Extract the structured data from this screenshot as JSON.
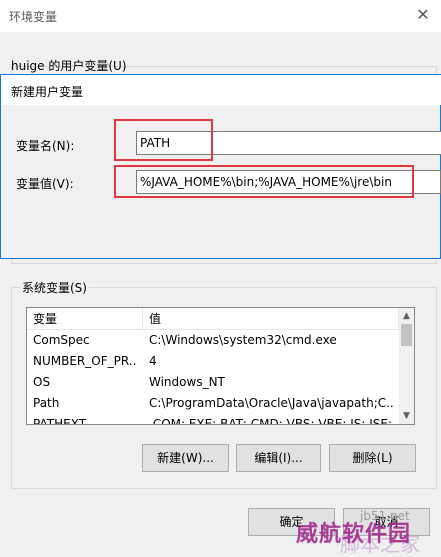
{
  "outer_window": {
    "title": "环境变量",
    "close_glyph": "✕",
    "user_vars_label": "huige 的用户变量(U)",
    "system_vars_label": "系统变量(S)"
  },
  "dialog": {
    "title": "新建用户变量",
    "name_label": "变量名(N):",
    "name_value": "PATH",
    "value_label": "变量值(V):",
    "value_value": "%JAVA_HOME%\\bin;%JAVA_HOME%\\jre\\bin"
  },
  "system_table": {
    "headers": [
      "变量",
      "值"
    ],
    "rows": [
      {
        "var": "ComSpec",
        "val": "C:\\Windows\\system32\\cmd.exe"
      },
      {
        "var": "NUMBER_OF_PR...",
        "val": "4"
      },
      {
        "var": "OS",
        "val": "Windows_NT"
      },
      {
        "var": "Path",
        "val": "C:\\ProgramData\\Oracle\\Java\\javapath;C..."
      },
      {
        "var": "PATHEXT",
        "val": ".COM;.EXE;.BAT;.CMD;.VBS;.VBE;.JS;.JSE;..."
      }
    ],
    "scroll_up_glyph": "▲",
    "scroll_down_glyph": "▼"
  },
  "buttons": {
    "new": "新建(W)...",
    "edit": "编辑(I)...",
    "delete": "删除(L)",
    "ok": "确定",
    "cancel": "取消"
  },
  "watermark": {
    "site": "jb51.net",
    "text": "威航软件园",
    "text2": "脚本之家"
  },
  "colors": {
    "highlight_box": "#e0393e",
    "dialog_border": "#1979ca"
  }
}
